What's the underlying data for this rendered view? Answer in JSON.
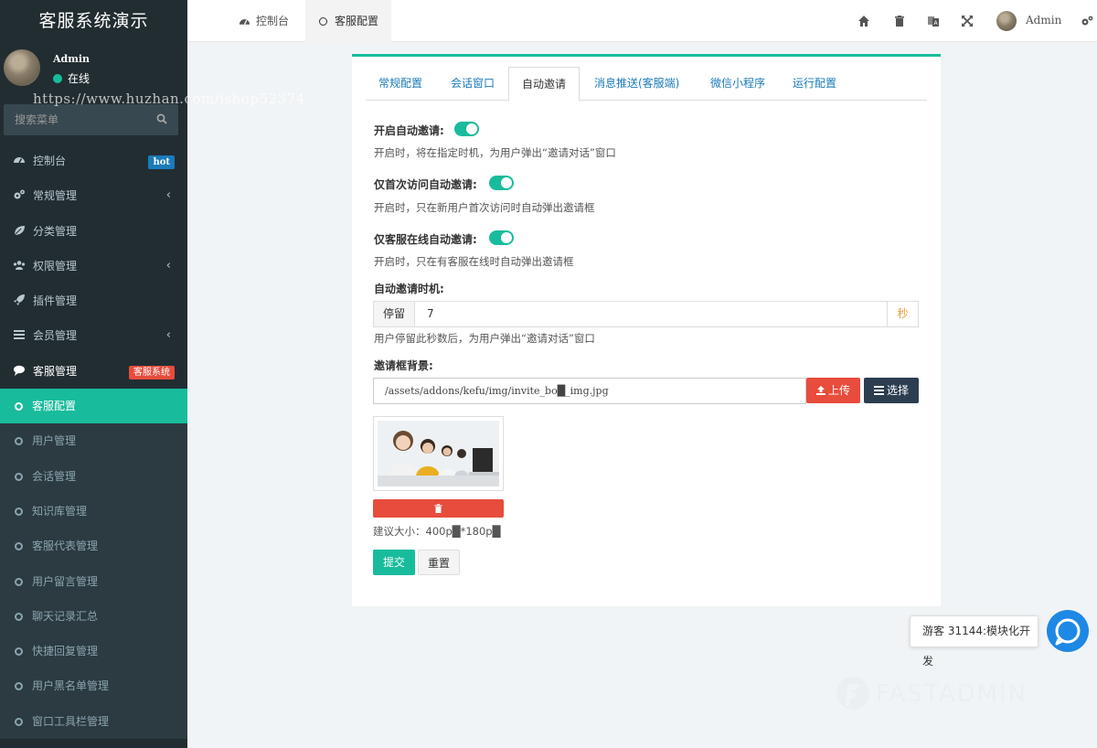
{
  "sidebar": {
    "brand": "客服系统演示",
    "user": {
      "name": "Admin",
      "status": "在线"
    },
    "watermark": "https://www.huzhan.com/ishop52374",
    "search_placeholder": "搜索菜单",
    "items": [
      {
        "label": "控制台",
        "icon": "dashboard-icon",
        "badge": "hot"
      },
      {
        "label": "常规管理",
        "icon": "cogs-icon",
        "chevron": "‹"
      },
      {
        "label": "分类管理",
        "icon": "leaf-icon"
      },
      {
        "label": "权限管理",
        "icon": "group-icon",
        "chevron": "‹"
      },
      {
        "label": "插件管理",
        "icon": "rocket-icon"
      },
      {
        "label": "会员管理",
        "icon": "list-icon",
        "chevron": "‹"
      },
      {
        "label": "客服管理",
        "icon": "comment-icon",
        "badge": "客服系统"
      },
      {
        "label": "客服配置",
        "icon": "circle-icon"
      },
      {
        "label": "用户管理",
        "icon": "circle-icon"
      },
      {
        "label": "会话管理",
        "icon": "circle-icon"
      },
      {
        "label": "知识库管理",
        "icon": "circle-icon"
      },
      {
        "label": "客服代表管理",
        "icon": "circle-icon"
      },
      {
        "label": "用户留言管理",
        "icon": "circle-icon"
      },
      {
        "label": "聊天记录汇总",
        "icon": "circle-icon"
      },
      {
        "label": "快捷回复管理",
        "icon": "circle-icon"
      },
      {
        "label": "用户黑名单管理",
        "icon": "circle-icon"
      },
      {
        "label": "窗口工具栏管理",
        "icon": "circle-icon"
      }
    ]
  },
  "header": {
    "tabs": [
      {
        "label": "控制台",
        "icon": "dashboard-icon"
      },
      {
        "label": "客服配置",
        "icon": "circle-icon"
      }
    ],
    "user": "Admin"
  },
  "panel": {
    "tabs": [
      "常规配置",
      "会话窗口",
      "自动邀请",
      "消息推送(客服端)",
      "微信小程序",
      "运行配置"
    ],
    "active_tab": "自动邀请",
    "fields": {
      "auto_invite": {
        "label": "开启自动邀请:",
        "help": "开启时，将在指定时机，为用户弹出“邀请对话”窗口",
        "on": true
      },
      "first_visit": {
        "label": "仅首次访问自动邀请:",
        "help": "开启时，只在新用户首次访问时自动弹出邀请框",
        "on": true
      },
      "online_only": {
        "label": "仅客服在线自动邀请:",
        "help": "开启时，只在有客服在线时自动弹出邀请框",
        "on": true
      },
      "timing": {
        "label": "自动邀请时机:",
        "prefix": "停留",
        "value": "7",
        "suffix": "秒",
        "help": "用户停留此秒数后，为用户弹出“邀请对话”窗口"
      },
      "background": {
        "label": "邀请框背景:",
        "path": "/assets/addons/kefu/img/invite_bo█_img.jpg",
        "upload": "上传",
        "choose": "选择",
        "thumb_caption": "您好!请问有什么能够帮您?",
        "size_hint": "建议大小：400p█*180p█"
      }
    },
    "submit": "提交",
    "reset": "重置"
  },
  "chat": {
    "tip": "游客 31144:模块化开发"
  },
  "footer_logo": "FASTADMIN",
  "colors": {
    "accent": "#18bc9c",
    "sidebar": "#222d32",
    "danger": "#e74c3c",
    "dark": "#2c3e50",
    "link": "#1a7bb9"
  }
}
